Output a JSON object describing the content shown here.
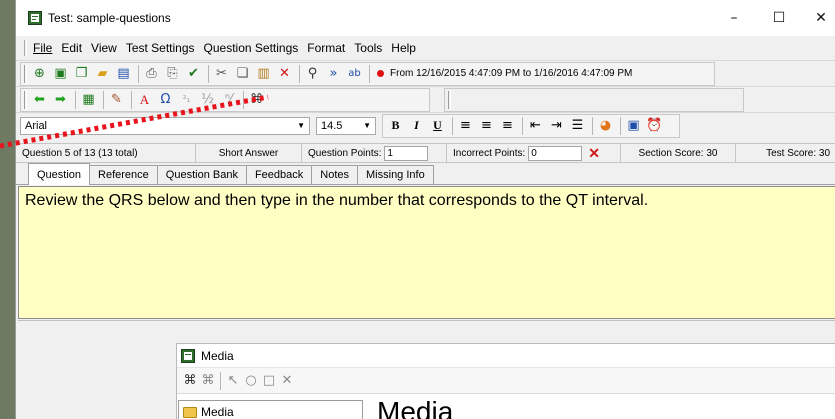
{
  "window": {
    "title": "Test: sample-questions"
  },
  "window_controls": {
    "minimize": "–",
    "maximize": "☐",
    "close": "✕"
  },
  "menu": [
    "File",
    "Edit",
    "View",
    "Test Settings",
    "Question Settings",
    "Format",
    "Tools",
    "Help"
  ],
  "toolbar": {
    "date_range": "From 12/16/2015 4:47:09 PM to 1/16/2016 4:47:09 PM"
  },
  "format_bar": {
    "font": "Arial",
    "size": "14.5"
  },
  "info_bar": {
    "question_position": "Question 5 of 13 (13 total)",
    "question_type": "Short Answer",
    "points_label": "Question Points:",
    "points_value": "1",
    "incorrect_label": "Incorrect Points:",
    "incorrect_value": "0",
    "section_score": "Section Score: 30",
    "test_score": "Test Score: 30"
  },
  "tabs": [
    "Question",
    "Reference",
    "Question Bank",
    "Feedback",
    "Notes",
    "Missing Info"
  ],
  "active_tab": "Question",
  "question_text": "Review the QRS below and then type in the number that corresponds to the QT interval.",
  "media": {
    "window_title": "Media",
    "tree_item": "Media",
    "heading": "Media"
  },
  "colors": {
    "question_bg": "#ffffc4",
    "annotation": "#e8141b",
    "desktop": "#6f7a63"
  },
  "icons": {
    "toolbar1": [
      "new-question-icon",
      "open-icon",
      "copy-question-icon",
      "folder-open-icon",
      "save-icon",
      "print-icon",
      "print-preview-icon",
      "spellcheck-icon",
      "cut-icon",
      "copy-icon",
      "paste-icon",
      "delete-icon",
      "find-icon",
      "next-icon",
      "replace-icon",
      "record-icon"
    ],
    "toolbar2": [
      "back-arrow-icon",
      "forward-arrow-icon",
      "question-list-icon",
      "highlight-icon",
      "font-size-icon",
      "symbol-icon",
      "superscript-icon",
      "fraction-icon",
      "math-icon",
      "media-icon"
    ]
  }
}
